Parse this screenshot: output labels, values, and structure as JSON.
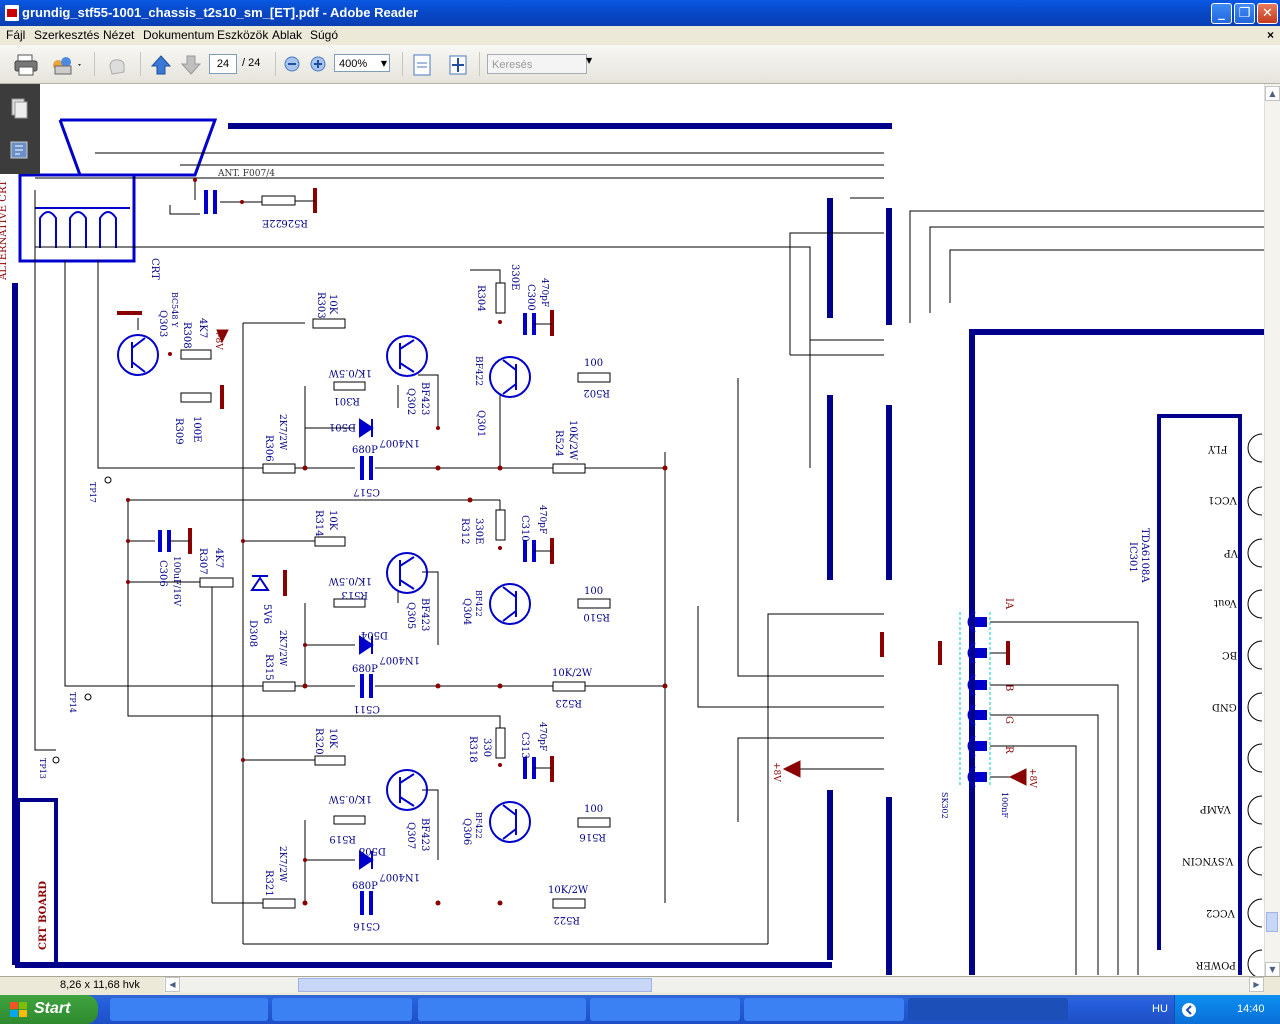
{
  "window": {
    "title": "grundig_stf55-1001_chassis_t2s10_sm_[ET].pdf - Adobe Reader"
  },
  "menu": [
    "Fájl",
    "Szerkesztés",
    "Nézet",
    "Dokumentum",
    "Eszközök",
    "Ablak",
    "Súgó"
  ],
  "toolbar": {
    "page_current": "24",
    "page_total": "/ 24",
    "zoom": "400%",
    "search_placeholder": "Keresés"
  },
  "status": {
    "page_size": "8,26 x 11,68 hvk"
  },
  "taskbar": {
    "start_label": "Start",
    "language": "HU",
    "clock": "14:40"
  },
  "schematic": {
    "side_labels": [
      "ALTERNATIVE CRT",
      "CRT",
      "CRT BOARD",
      "ANT. F007/4"
    ],
    "transistors": [
      {
        "ref": "Q303",
        "part": "BC548 Y"
      },
      {
        "ref": "Q302",
        "part": "BF423"
      },
      {
        "ref": "Q301",
        "part": "BF422"
      },
      {
        "ref": "Q305",
        "part": "BF423"
      },
      {
        "ref": "Q304",
        "part": "BF422"
      },
      {
        "ref": "Q307",
        "part": "BF423"
      },
      {
        "ref": "Q306",
        "part": "BF422"
      }
    ],
    "resistors": [
      {
        "ref": "R526",
        "value": "22E"
      },
      {
        "ref": "R303",
        "value": "10K"
      },
      {
        "ref": "R301",
        "value": "1K/0.5W"
      },
      {
        "ref": "R304",
        "value": "330E"
      },
      {
        "ref": "R308",
        "value": "4K7"
      },
      {
        "ref": "R309",
        "value": "100E"
      },
      {
        "ref": "R502",
        "value": "100"
      },
      {
        "ref": "R524",
        "value": "10K/2W"
      },
      {
        "ref": "R306",
        "value": "2K7/2W"
      },
      {
        "ref": "R314",
        "value": "10K"
      },
      {
        "ref": "R312",
        "value": "330E"
      },
      {
        "ref": "R307",
        "value": "4K7"
      },
      {
        "ref": "R513",
        "value": "1K/0.5W"
      },
      {
        "ref": "R510",
        "value": "100"
      },
      {
        "ref": "R315",
        "value": "2K7/2W"
      },
      {
        "ref": "R523",
        "value": "10K/2W"
      },
      {
        "ref": "R320",
        "value": "10K"
      },
      {
        "ref": "R318",
        "value": "330"
      },
      {
        "ref": "R519",
        "value": "1K/0.5W"
      },
      {
        "ref": "R516",
        "value": "100"
      },
      {
        "ref": "R321",
        "value": "2K7/2W"
      },
      {
        "ref": "R522",
        "value": "10K/2W"
      }
    ],
    "capacitors": [
      {
        "ref": "C300",
        "value": "470pF"
      },
      {
        "ref": "C517",
        "value": "680P"
      },
      {
        "ref": "C310",
        "value": "470pF"
      },
      {
        "ref": "C306",
        "value": "100uF/16V"
      },
      {
        "ref": "C511",
        "value": "680P"
      },
      {
        "ref": "C313",
        "value": "470pF"
      },
      {
        "ref": "C516",
        "value": "680P"
      }
    ],
    "diodes": [
      {
        "ref": "D501",
        "part": "1N4007"
      },
      {
        "ref": "D308",
        "part": "5V6"
      },
      {
        "ref": "D504",
        "part": "1N4007"
      },
      {
        "ref": "D508",
        "part": "1N4007"
      }
    ],
    "test_points": [
      "TP17",
      "TP14",
      "TP13"
    ],
    "connector": {
      "ref": "SK302",
      "pin_labels": [
        "IA",
        "B",
        "G",
        "R"
      ]
    },
    "ic": {
      "ref": "IC301",
      "part": "TDA6108A",
      "pins": [
        "FLY",
        "VCC1",
        "VP",
        "Vout",
        "BC",
        "GND",
        "",
        "VAMP",
        "V.SYNCIN",
        "VCC2",
        "POWER"
      ]
    },
    "supply": [
      "+8V",
      "+8V",
      "+8V"
    ],
    "other": [
      "100nF"
    ]
  }
}
